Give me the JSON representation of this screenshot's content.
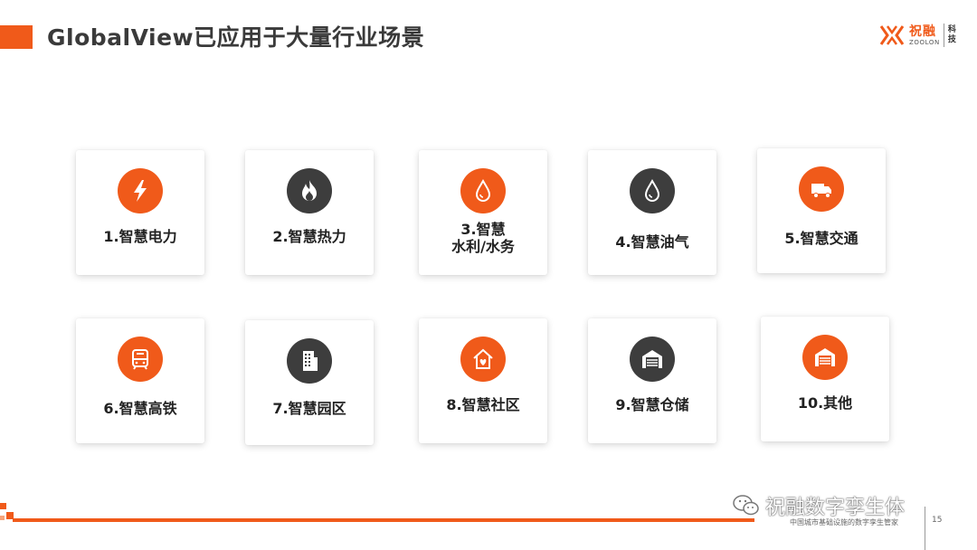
{
  "header": {
    "title": "GlobalView已应用于大量行业场景",
    "logo_cn": "祝融",
    "logo_en": "ZOOLON",
    "logo_ke_1": "科",
    "logo_ke_2": "技"
  },
  "cards": [
    {
      "label_1": "1.智慧电力",
      "label_2": "",
      "icon": "lightning-icon",
      "color": "#f05a1a"
    },
    {
      "label_1": "2.智慧热力",
      "label_2": "",
      "icon": "flame-icon",
      "color": "#3d3d3d"
    },
    {
      "label_1": "3.智慧",
      "label_2": "水利/水务",
      "icon": "water-drop-icon",
      "color": "#f05a1a"
    },
    {
      "label_1": "4.智慧油气",
      "label_2": "",
      "icon": "oil-drop-icon",
      "color": "#3d3d3d"
    },
    {
      "label_1": "5.智慧交通",
      "label_2": "",
      "icon": "truck-icon",
      "color": "#f05a1a"
    },
    {
      "label_1": "6.智慧高铁",
      "label_2": "",
      "icon": "train-icon",
      "color": "#f05a1a"
    },
    {
      "label_1": "7.智慧园区",
      "label_2": "",
      "icon": "building-icon",
      "color": "#3d3d3d"
    },
    {
      "label_1": "8.智慧社区",
      "label_2": "",
      "icon": "community-house-icon",
      "color": "#f05a1a"
    },
    {
      "label_1": "9.智慧仓储",
      "label_2": "",
      "icon": "warehouse-icon",
      "color": "#3d3d3d"
    },
    {
      "label_1": "10.其他",
      "label_2": "",
      "icon": "garage-icon",
      "color": "#f05a1a"
    }
  ],
  "footer": {
    "text": "中国城市基础设施的数字孪生管家",
    "page": "15",
    "watermark": "祝融数字孪生体"
  }
}
